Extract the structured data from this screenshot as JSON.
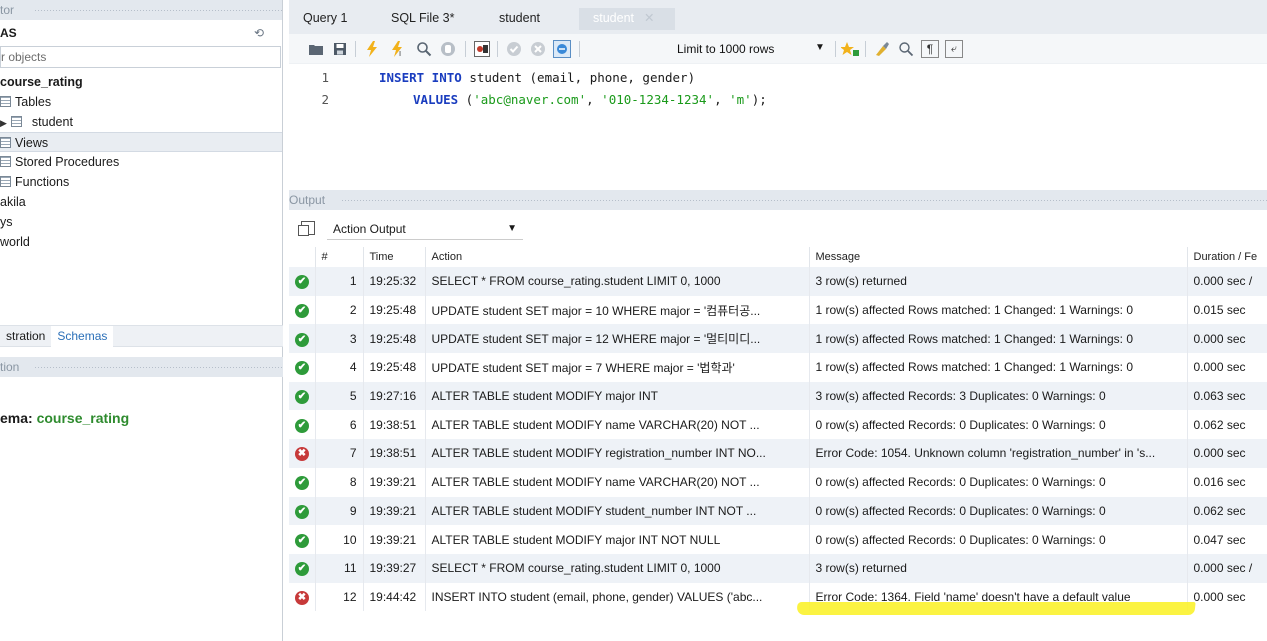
{
  "navigator": {
    "header_label": "tor",
    "schemas_label": "AS",
    "filter_placeholder": "r objects",
    "tree": [
      {
        "label": "course_rating",
        "bold": true,
        "type": "schema"
      },
      {
        "label": "Tables",
        "type": "folder"
      },
      {
        "label": "student",
        "type": "table"
      },
      {
        "label": "Views",
        "type": "folder",
        "selected": true
      },
      {
        "label": "Stored Procedures",
        "type": "folder"
      },
      {
        "label": "Functions",
        "type": "folder"
      },
      {
        "label": "akila",
        "type": "schema"
      },
      {
        "label": "ys",
        "type": "schema"
      },
      {
        "label": "world",
        "type": "schema"
      }
    ],
    "bottom_tabs": {
      "administration": "stration",
      "schemas": "Schemas"
    },
    "info_header": "tion",
    "schema_info_label": "ema:",
    "schema_info_value": "course_rating"
  },
  "editor": {
    "tabs": [
      "Query 1",
      "SQL File 3*",
      "student",
      "student"
    ],
    "limit_label": "Limit to 1000 rows",
    "code": {
      "line1": {
        "num": "1",
        "kw1": "INSERT INTO",
        "rest": " student (email, phone, gender)"
      },
      "line2": {
        "num": "2",
        "kw": "VALUES",
        "open": " (",
        "s1": "'abc@naver.com'",
        "c1": ", ",
        "s2": "'010-1234-1234'",
        "c2": ", ",
        "s3": "'m'",
        "close": ");"
      }
    }
  },
  "output": {
    "header_label": "Output",
    "selector_label": "Action Output",
    "columns": {
      "num": "#",
      "time": "Time",
      "action": "Action",
      "message": "Message",
      "duration": "Duration / Fe"
    },
    "rows": [
      {
        "status": "ok",
        "num": "1",
        "time": "19:25:32",
        "action": "SELECT * FROM course_rating.student LIMIT 0, 1000",
        "message": "3 row(s) returned",
        "duration": "0.000 sec / "
      },
      {
        "status": "ok",
        "num": "2",
        "time": "19:25:48",
        "action": "UPDATE student SET major = 10 WHERE major = '컴퓨터공...",
        "message": "1 row(s) affected Rows matched: 1  Changed: 1  Warnings: 0",
        "duration": "0.015 sec"
      },
      {
        "status": "ok",
        "num": "3",
        "time": "19:25:48",
        "action": "UPDATE student SET major = 12 WHERE major = '멀티미디...",
        "message": "1 row(s) affected Rows matched: 1  Changed: 1  Warnings: 0",
        "duration": "0.000 sec"
      },
      {
        "status": "ok",
        "num": "4",
        "time": "19:25:48",
        "action": "UPDATE student SET major = 7 WHERE major = '법학과'",
        "message": "1 row(s) affected Rows matched: 1  Changed: 1  Warnings: 0",
        "duration": "0.000 sec"
      },
      {
        "status": "ok",
        "num": "5",
        "time": "19:27:16",
        "action": "ALTER TABLE student MODIFY major INT",
        "message": "3 row(s) affected Records: 3  Duplicates: 0  Warnings: 0",
        "duration": "0.063 sec"
      },
      {
        "status": "ok",
        "num": "6",
        "time": "19:38:51",
        "action": "ALTER TABLE student MODIFY name VARCHAR(20) NOT ...",
        "message": "0 row(s) affected Records: 0  Duplicates: 0  Warnings: 0",
        "duration": "0.062 sec"
      },
      {
        "status": "err",
        "num": "7",
        "time": "19:38:51",
        "action": "ALTER TABLE student MODIFY registration_number INT NO...",
        "message": "Error Code: 1054. Unknown column 'registration_number' in 's...",
        "duration": "0.000 sec"
      },
      {
        "status": "ok",
        "num": "8",
        "time": "19:39:21",
        "action": "ALTER TABLE student MODIFY name VARCHAR(20) NOT ...",
        "message": "0 row(s) affected Records: 0  Duplicates: 0  Warnings: 0",
        "duration": "0.016 sec"
      },
      {
        "status": "ok",
        "num": "9",
        "time": "19:39:21",
        "action": "ALTER TABLE student MODIFY student_number INT NOT ...",
        "message": "0 row(s) affected Records: 0  Duplicates: 0  Warnings: 0",
        "duration": "0.062 sec"
      },
      {
        "status": "ok",
        "num": "10",
        "time": "19:39:21",
        "action": "ALTER TABLE student MODIFY major INT NOT NULL",
        "message": "0 row(s) affected Records: 0  Duplicates: 0  Warnings: 0",
        "duration": "0.047 sec"
      },
      {
        "status": "ok",
        "num": "11",
        "time": "19:39:27",
        "action": "SELECT * FROM course_rating.student LIMIT 0, 1000",
        "message": "3 row(s) returned",
        "duration": "0.000 sec / "
      },
      {
        "status": "err",
        "num": "12",
        "time": "19:44:42",
        "action": "INSERT INTO student (email, phone, gender) VALUES ('abc...",
        "message": "Error Code: 1364. Field 'name' doesn't have a default value",
        "duration": "0.000 sec"
      }
    ]
  },
  "colors": {
    "ok": "#2e9b3a",
    "err": "#c73a3a",
    "highlight": "#fbf22e",
    "keyword": "#1a3dbf",
    "string": "#1a9a1a"
  }
}
